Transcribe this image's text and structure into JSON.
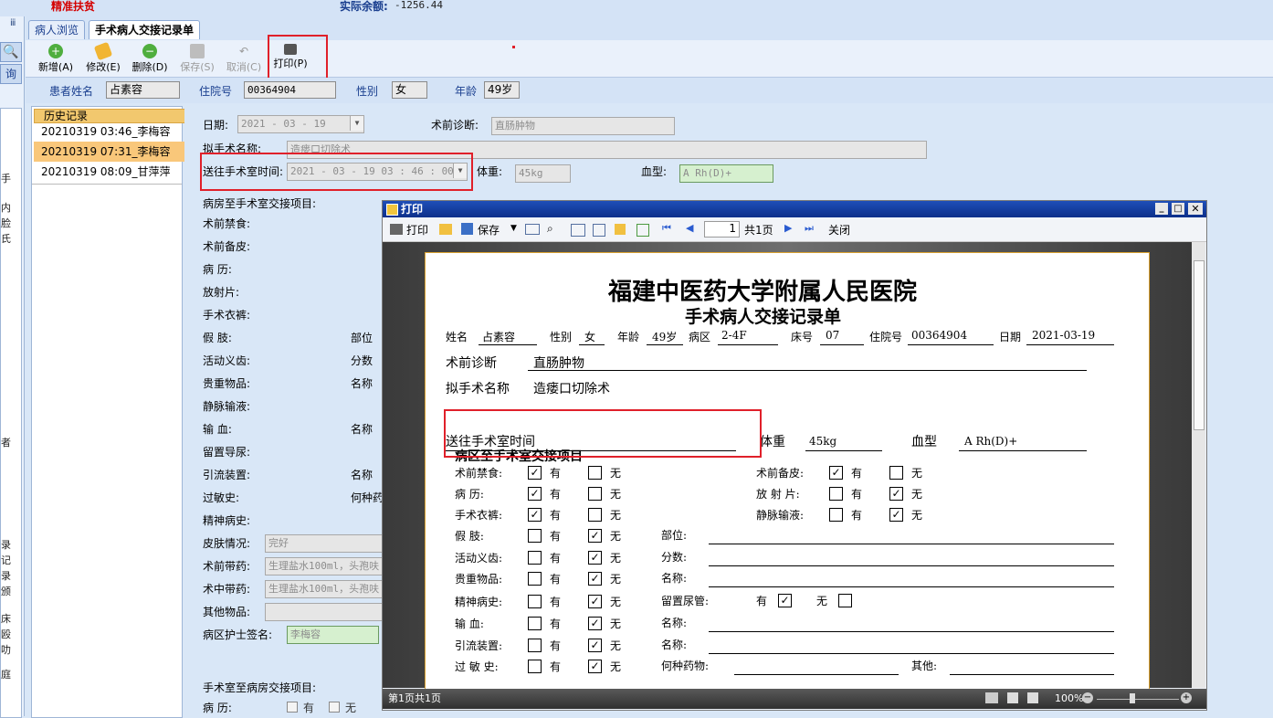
{
  "header": {
    "red_title": "精准扶贫",
    "balance_label": "实际余额:",
    "balance_value": "-1256.44"
  },
  "left_strip": {
    "pin": "ⅲ",
    "query_label": "询",
    "side_chars": [
      "手",
      "内",
      "脸",
      "氏",
      "者",
      "录",
      "记",
      "录",
      "颁",
      "床",
      "殴",
      "叻",
      "庭"
    ]
  },
  "tabs": [
    {
      "label": "病人浏览"
    },
    {
      "label": "手术病人交接记录单"
    }
  ],
  "toolbar": {
    "add": "新增(A)",
    "edit": "修改(E)",
    "delete": "删除(D)",
    "save": "保存(S)",
    "cancel": "取消(C)",
    "print": "打印(P)"
  },
  "patient": {
    "name_label": "患者姓名",
    "name": "占素容",
    "admission_label": "住院号",
    "admission": "00364904",
    "sex_label": "性别",
    "sex": "女",
    "age_label": "年龄",
    "age": "49岁"
  },
  "history": {
    "title": "历史记录",
    "items": [
      "20210319 03:46_李梅容",
      "20210319 07:31_李梅容",
      "20210319 08:09_甘萍萍"
    ]
  },
  "form": {
    "date_label": "日期:",
    "date_value": "2021 - 03 - 19",
    "pre_diag_label": "术前诊断:",
    "pre_diag_value": "直肠肿物",
    "planned_op_label": "拟手术名称:",
    "planned_op_value": "造瘘口切除术",
    "send_time_label": "送往手术室时间:",
    "send_time_value": "2021 - 03 - 19    03 : 46 : 00",
    "weight_label": "体重:",
    "weight_value": "45kg",
    "blood_label": "血型:",
    "blood_value": "A Rh(D)+",
    "section1": "病房至手术室交接项目:",
    "yes": "有",
    "no": "无",
    "items": [
      "术前禁食:",
      "术前备皮:",
      "病    历:",
      "放射片:",
      "手术衣裤:",
      "假    肢:",
      "活动义齿:",
      "贵重物品:",
      "静脉输液:",
      "输    血:",
      "留置导尿:",
      "引流装置:",
      "过敏史:",
      "精神病史:"
    ],
    "side_labels": [
      "部位",
      "分数",
      "名称",
      "名称",
      "名称",
      "何种药"
    ],
    "skin_label": "皮肤情况:",
    "skin_value": "完好",
    "preop_drug_label": "术前带药:",
    "preop_drug_value": "生理盐水100ml，头孢呋",
    "intraop_drug_label": "术中带药:",
    "intraop_drug_value": "生理盐水100ml，头孢呋",
    "other_label": "其他物品:",
    "nurse_label": "病区护士签名:",
    "nurse_value": "李梅容",
    "section2": "手术室至病房交接项目:",
    "record_item": "病    历:"
  },
  "dialog": {
    "title": "打印",
    "tb_print": "打印",
    "tb_save": "保存",
    "page_input": "1",
    "page_total": "共1页",
    "close": "关闭",
    "status": "第1页共1页",
    "zoom": "100%"
  },
  "doc": {
    "hospital": "福建中医药大学附属人民医院",
    "title": "手术病人交接记录单",
    "name_label": "姓名",
    "name": "占素容",
    "sex_label": "性别",
    "sex": "女",
    "age_label": "年龄",
    "age": "49岁",
    "ward_label": "病区",
    "ward": "2-4F",
    "bed_label": "床号",
    "bed": "07",
    "admission_label": "住院号",
    "admission": "00364904",
    "date_label": "日期",
    "date": "2021-03-19",
    "diag_label": "术前诊断",
    "diag": "直肠肿物",
    "op_label": "拟手术名称",
    "op": "造瘘口切除术",
    "send_label": "送往手术室时间",
    "weight_label": "体重",
    "weight": "45kg",
    "blood_label": "血型",
    "blood": "A Rh(D)+",
    "section": "病区至手术室交接项目",
    "yes": "有",
    "no": "无",
    "left_items": [
      "术前禁食:",
      "病    历:",
      "手术衣裤:",
      "假    肢:",
      "活动义齿:",
      "贵重物品:",
      "精神病史:",
      "输    血:",
      "引流装置:",
      "过 敏 史:"
    ],
    "right_items": [
      "术前备皮:",
      "放 射 片:",
      "静脉输液:"
    ],
    "part_label": "部位:",
    "score_label": "分数:",
    "name2_label": "名称:",
    "catheter_label": "留置尿管:",
    "drug_label": "何种药物:",
    "other_label": "其他:"
  }
}
